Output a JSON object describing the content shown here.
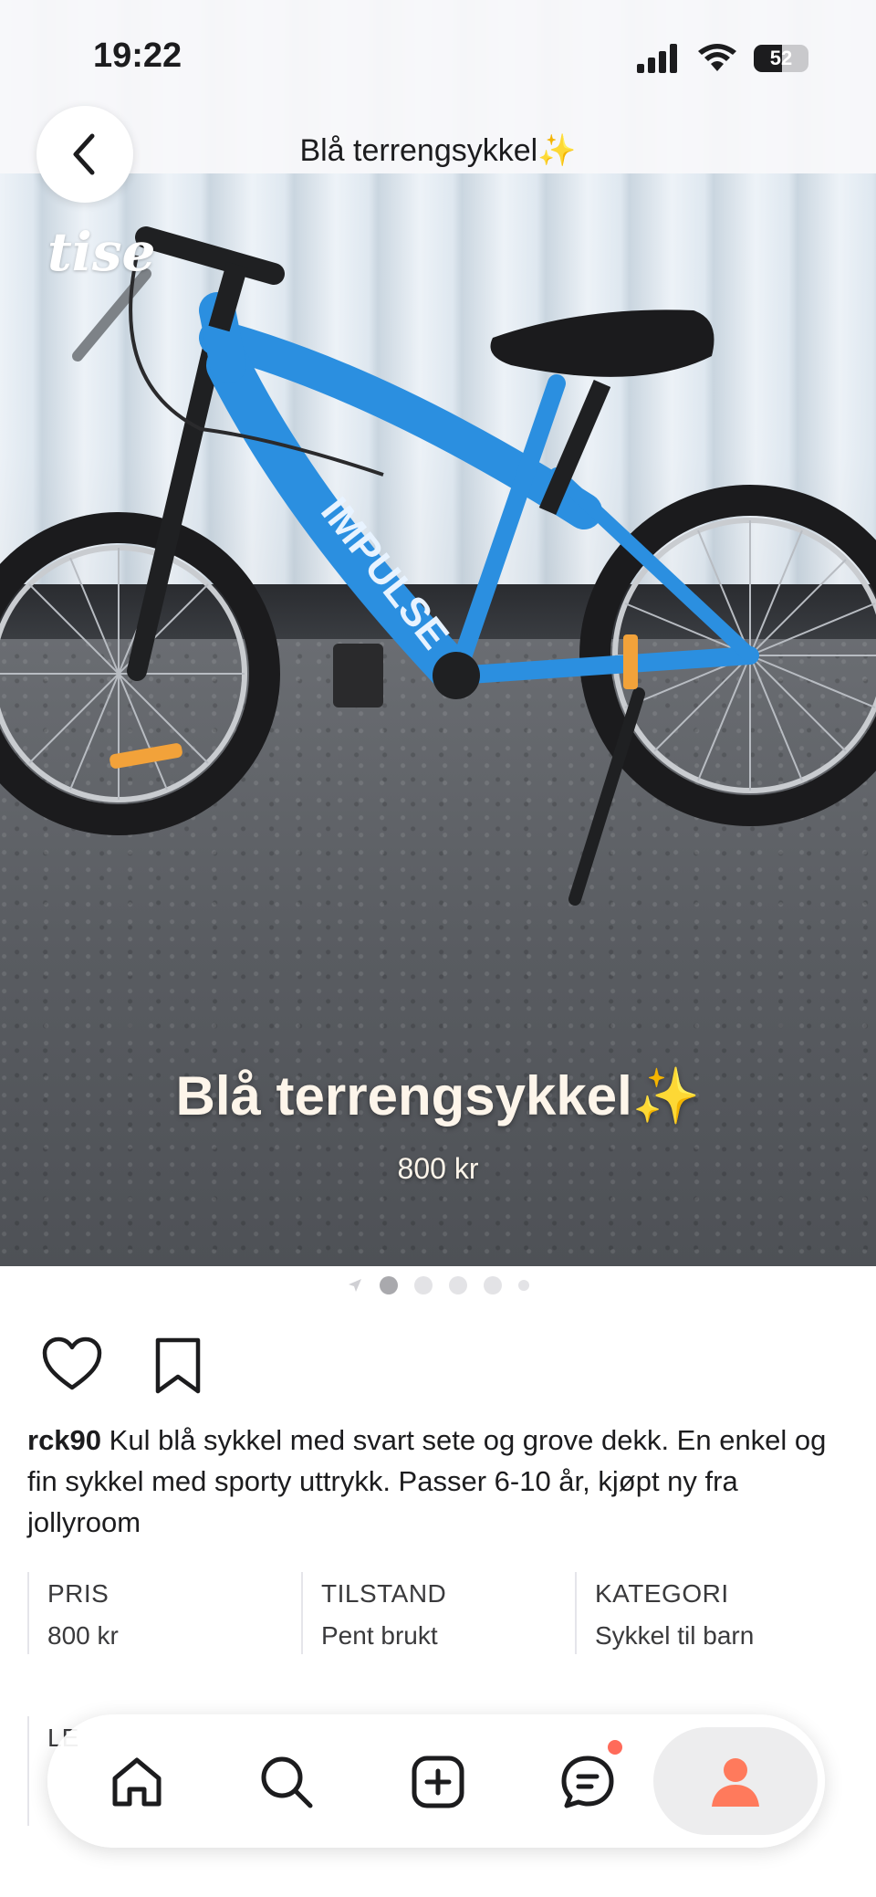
{
  "status_bar": {
    "time": "19:22",
    "battery": "52",
    "icons": [
      "cellular-signal-icon",
      "wifi-icon",
      "battery-icon"
    ]
  },
  "nav": {
    "title": "Blå terrengsykkel✨",
    "back_icon": "chevron-left-icon"
  },
  "photo": {
    "logo": "tise",
    "overlay_title": "Blå terrengsykkel✨",
    "overlay_price": "800 kr",
    "pager": {
      "count": 5,
      "active_index": 1
    }
  },
  "actions": {
    "like_icon": "heart-outline-icon",
    "save_icon": "bookmark-outline-icon"
  },
  "listing": {
    "username": "rck90",
    "description": "Kul blå sykkel med svart sete og grove dekk. En enkel og fin sykkel med sporty uttrykk. Passer 6-10 år, kjøpt ny fra jollyroom",
    "details": [
      {
        "label": "PRIS",
        "value": "800 kr"
      },
      {
        "label": "TILSTAND",
        "value": "Pent brukt"
      },
      {
        "label": "KATEGORI",
        "value": "Sykkel til barn"
      }
    ],
    "peek_label": "LE"
  },
  "tabbar": {
    "tabs": [
      {
        "name": "home",
        "icon": "home-icon"
      },
      {
        "name": "search",
        "icon": "search-icon"
      },
      {
        "name": "create",
        "icon": "plus-square-icon"
      },
      {
        "name": "messages",
        "icon": "chat-icon",
        "has_notification": true
      },
      {
        "name": "profile",
        "icon": "profile-icon",
        "active": true
      }
    ],
    "accent_color": "#ff7a5c"
  }
}
